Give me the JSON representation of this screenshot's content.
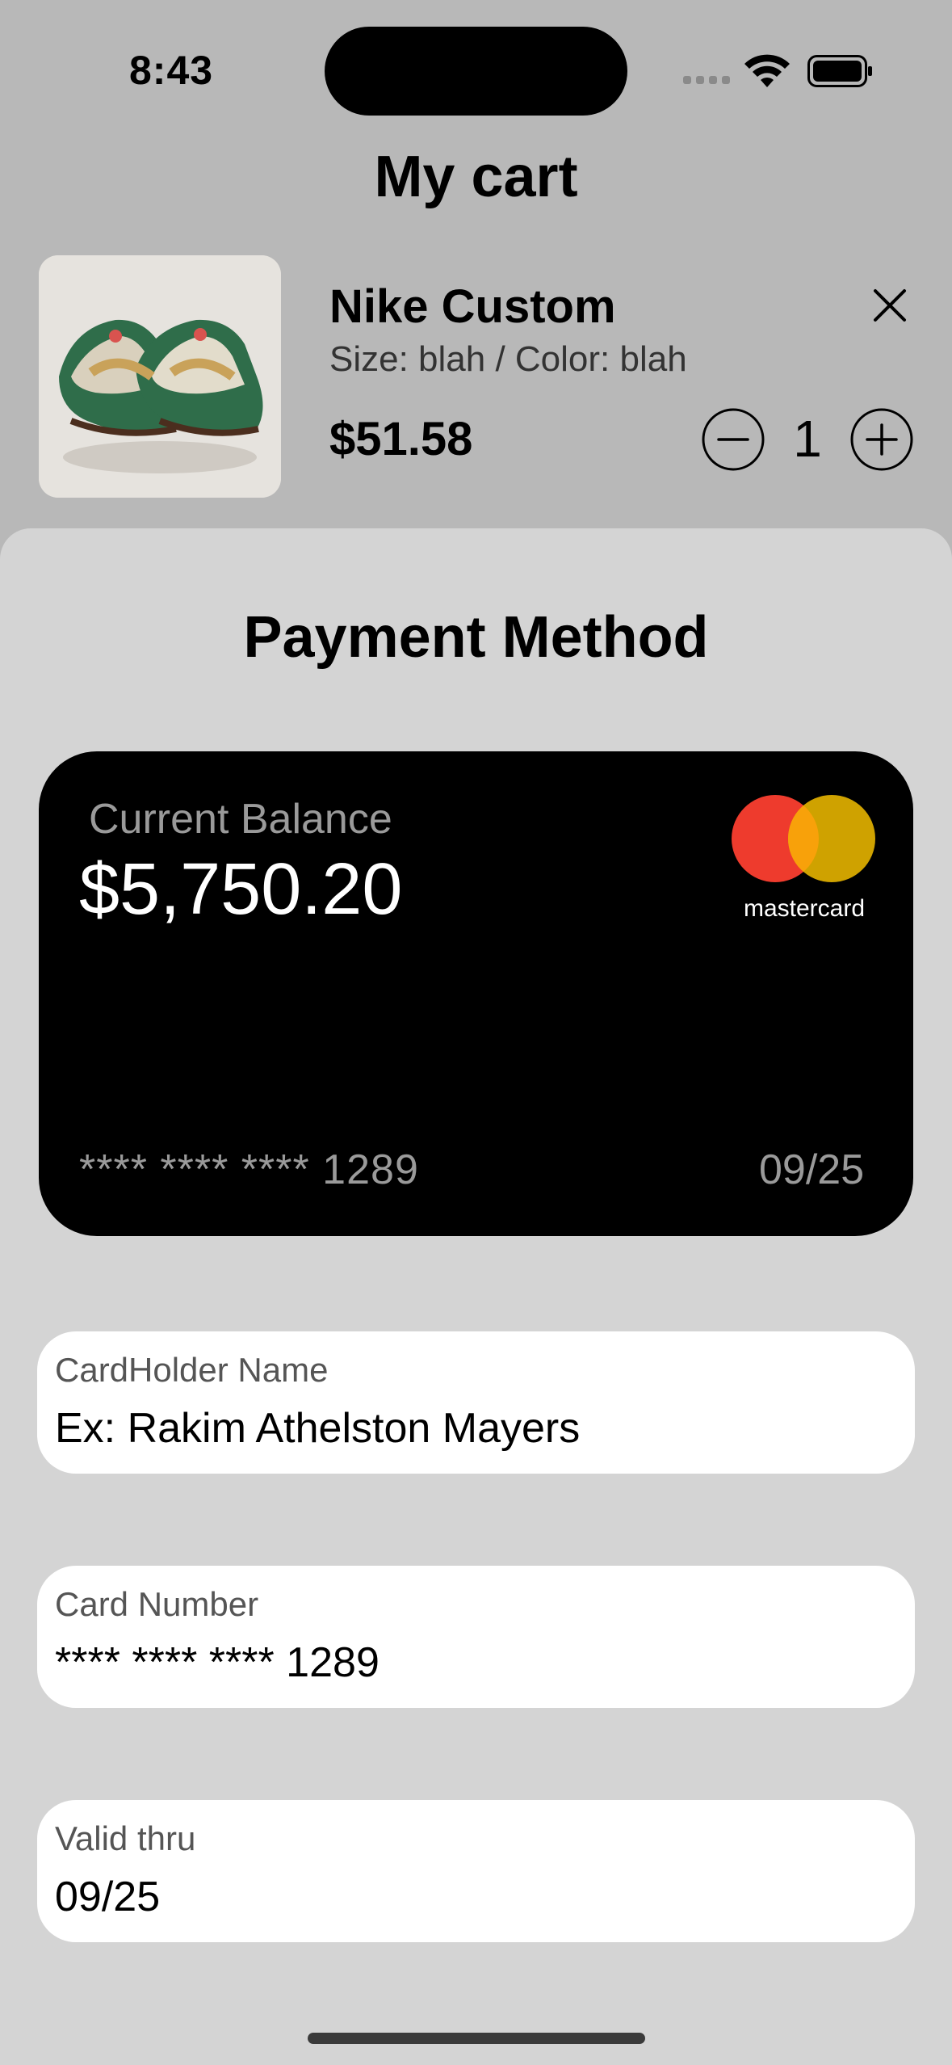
{
  "status_bar": {
    "time": "8:43"
  },
  "header": {
    "title": "My cart"
  },
  "cart_item": {
    "name": "Nike Custom",
    "variant": "Size: blah / Color: blah",
    "price": "$51.58",
    "quantity": "1"
  },
  "payment": {
    "title": "Payment Method",
    "card": {
      "balance_label": "Current Balance",
      "balance": "$5,750.20",
      "brand": "mastercard",
      "number": "**** **** **** 1289",
      "expiry": "09/25"
    },
    "fields": {
      "cardholder": {
        "label": "CardHolder Name",
        "value": "Ex: Rakim Athelston Mayers"
      },
      "card_number": {
        "label": "Card Number",
        "value": "**** **** **** 1289"
      },
      "valid_thru": {
        "label": "Valid thru",
        "value": "09/25"
      }
    }
  },
  "colors": {
    "background": "#b8b8b8",
    "sheet": "#d4d4d4",
    "card": "#000000",
    "mastercard_red": "#ee3b2d",
    "mastercard_yellow": "#cfa200"
  }
}
